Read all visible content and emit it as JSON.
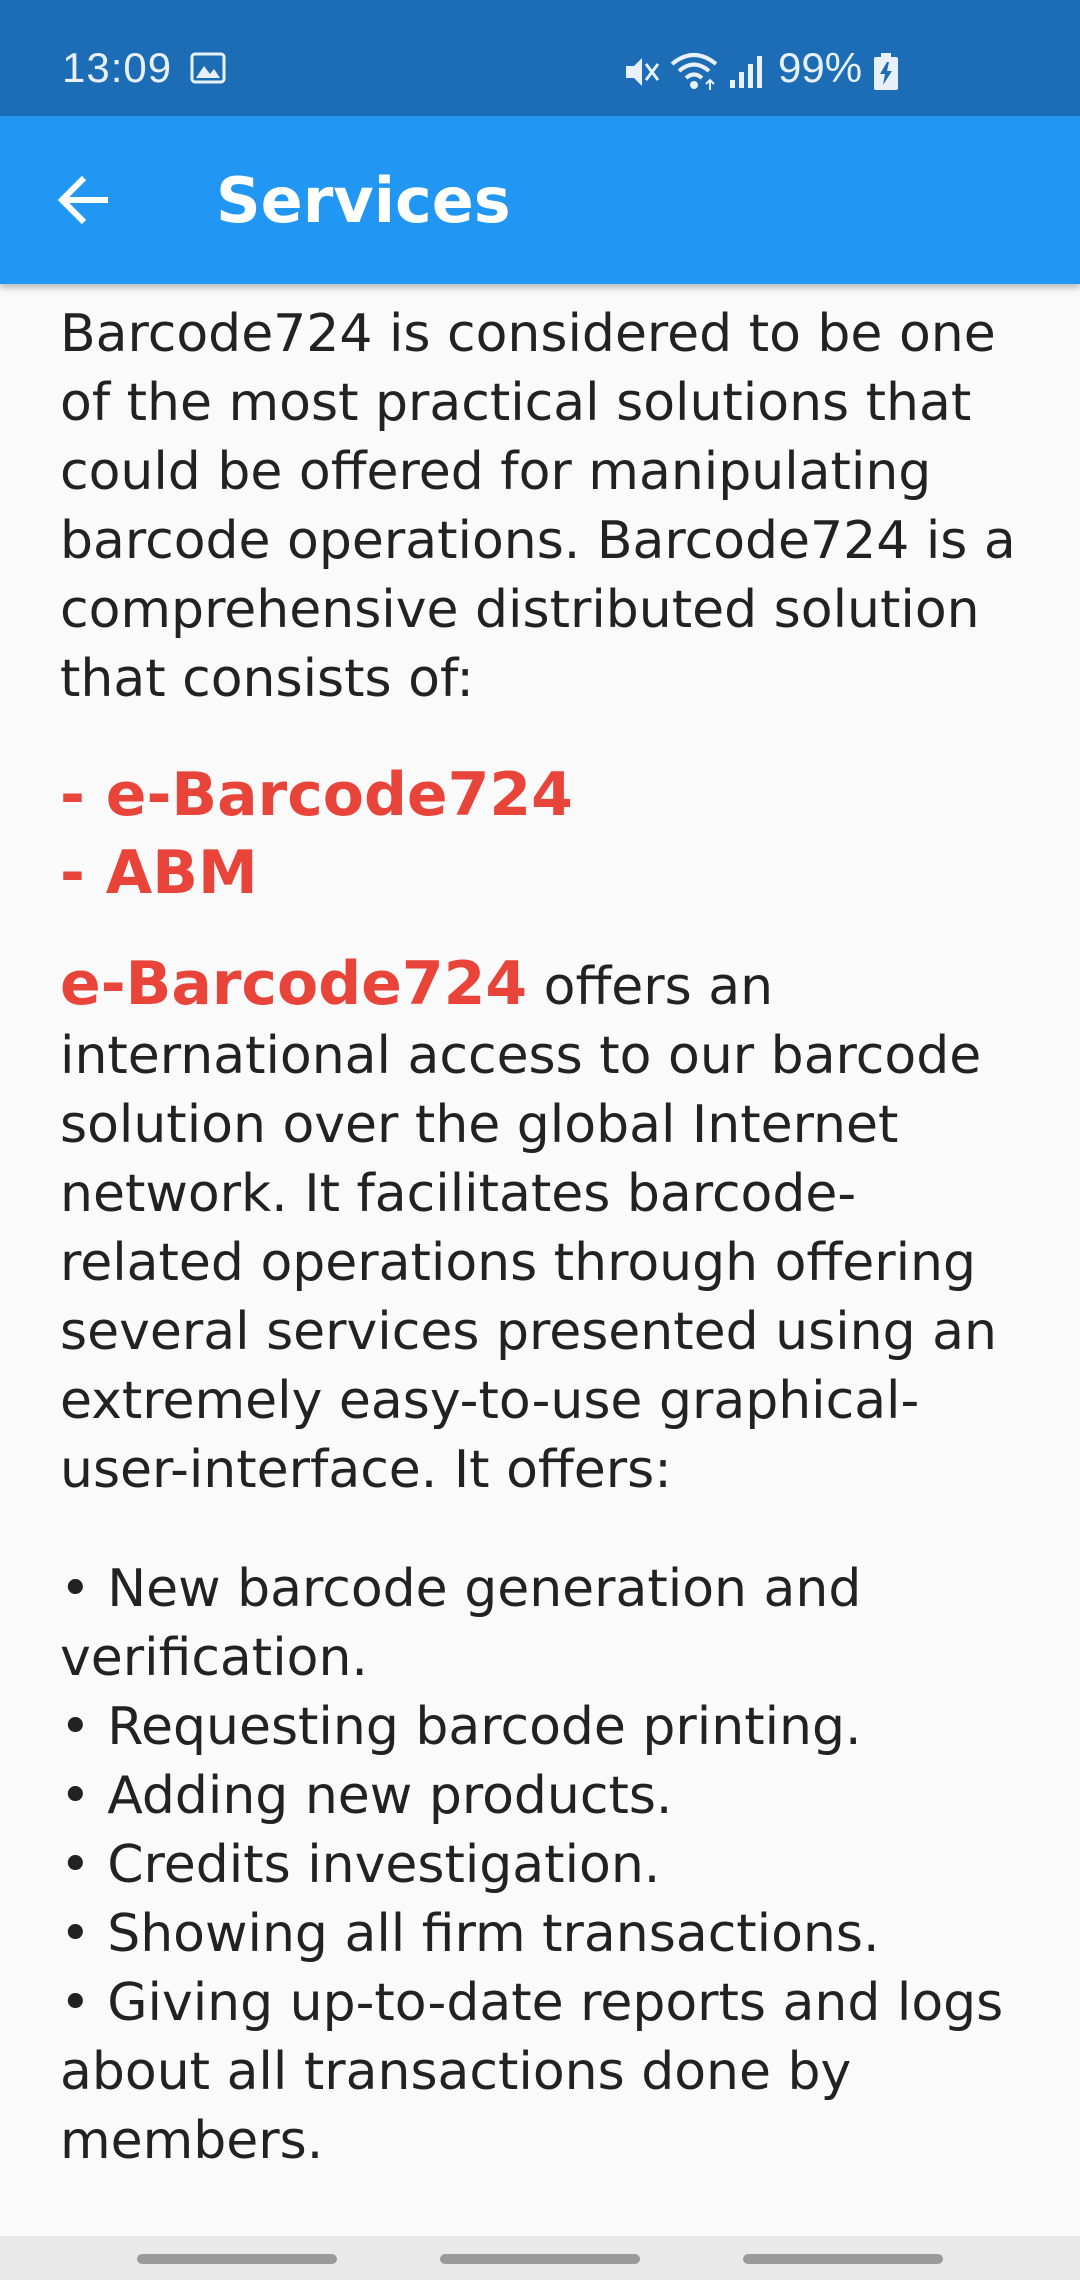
{
  "status_bar": {
    "time": "13:09",
    "battery": "99%",
    "icons": [
      "gallery-icon",
      "mute-icon",
      "wifi-icon",
      "signal-icon",
      "battery-charging-icon"
    ]
  },
  "app_bar": {
    "title": "Services",
    "back_icon": "arrow-back-icon"
  },
  "content": {
    "intro": "Barcode724 is considered to be one of the most practical solutions that could be offered for manipulating barcode operations. Barcode724 is a comprehensive distributed solution that consists of:",
    "components": [
      "- e-Barcode724",
      "- ABM"
    ],
    "ebarcode_name": "e-Barcode724",
    "ebarcode_text": " offers an international access to our barcode solution over the global Internet network. It facilitates barcode-related operations through offering several services presented using an extremely easy-to-use graphical-user-interface. It offers:",
    "offers": [
      "• New barcode generation and verification.",
      "• Requesting barcode printing.",
      "• Adding new products.",
      "• Credits investigation.",
      "• Showing all firm transactions.",
      "• Giving up-to-date reports and logs about all transactions done by members."
    ]
  },
  "colors": {
    "status_bar": "#1c6db5",
    "app_bar": "#2196f3",
    "accent_red": "#e8443a",
    "text": "#222222",
    "background": "#fafafa"
  }
}
